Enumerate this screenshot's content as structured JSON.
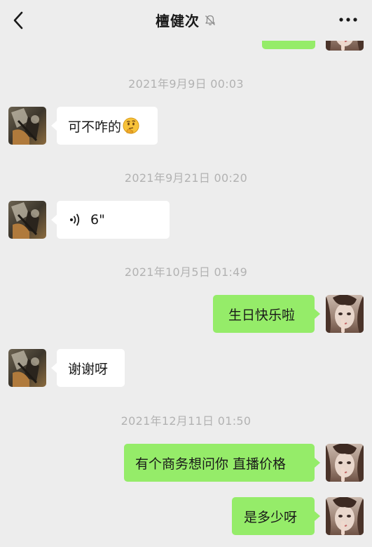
{
  "header": {
    "title": "檀健次",
    "mute_icon": "bell-slash-icon",
    "back_icon": "chevron-left-icon",
    "more_icon": "ellipsis-icon"
  },
  "colors": {
    "background": "#ededed",
    "incoming_bubble": "#ffffff",
    "outgoing_bubble": "#95ec69",
    "timestamp": "#b2b2b2"
  },
  "messages": [
    {
      "type": "timestamp",
      "text": "2021年9月9日 00:03"
    },
    {
      "type": "incoming",
      "text": "可不咋的",
      "emoji": "thinking-face-icon"
    },
    {
      "type": "timestamp",
      "text": "2021年9月21日 00:20"
    },
    {
      "type": "incoming-voice",
      "text": "6\"",
      "icon": "voice-icon"
    },
    {
      "type": "timestamp",
      "text": "2021年10月5日 01:49"
    },
    {
      "type": "outgoing",
      "text": "生日快乐啦"
    },
    {
      "type": "incoming",
      "text": "谢谢呀"
    },
    {
      "type": "timestamp",
      "text": "2021年12月11日 01:50"
    },
    {
      "type": "outgoing",
      "text": "有个商务想问你 直播价格"
    },
    {
      "type": "outgoing",
      "text": "是多少呀"
    }
  ]
}
